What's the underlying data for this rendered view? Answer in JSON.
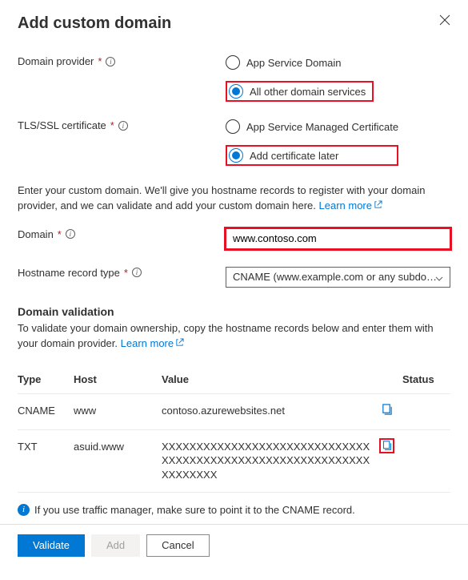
{
  "title": "Add custom domain",
  "fields": {
    "domain_provider_label": "Domain provider",
    "tls_label": "TLS/SSL certificate",
    "domain_label": "Domain",
    "hostname_type_label": "Hostname record type"
  },
  "radios": {
    "provider": {
      "opt1": "App Service Domain",
      "opt2": "All other domain services"
    },
    "tls": {
      "opt1": "App Service Managed Certificate",
      "opt2": "Add certificate later"
    }
  },
  "help_text_1": "Enter your custom domain. We'll give you hostname records to register with your domain provider, and we can validate and add your custom domain here. ",
  "learn_more": "Learn more",
  "domain_value": "www.contoso.com",
  "hostname_type_value": "CNAME (www.example.com or any subdo…",
  "validation": {
    "heading": "Domain validation",
    "desc": "To validate your domain ownership, copy the hostname records below and enter them with your domain provider. ",
    "cols": {
      "type": "Type",
      "host": "Host",
      "value": "Value",
      "status": "Status"
    },
    "rows": [
      {
        "type": "CNAME",
        "host": "www",
        "value": "contoso.azurewebsites.net"
      },
      {
        "type": "TXT",
        "host": "asuid.www",
        "value": "XXXXXXXXXXXXXXXXXXXXXXXXXXXXXXXXXXXXXXXXXXXXXXXXXXXXXXXXXXXXXXXXXXXX"
      }
    ]
  },
  "note": "If you use traffic manager, make sure to point it to the CNAME record.",
  "buttons": {
    "validate": "Validate",
    "add": "Add",
    "cancel": "Cancel"
  }
}
